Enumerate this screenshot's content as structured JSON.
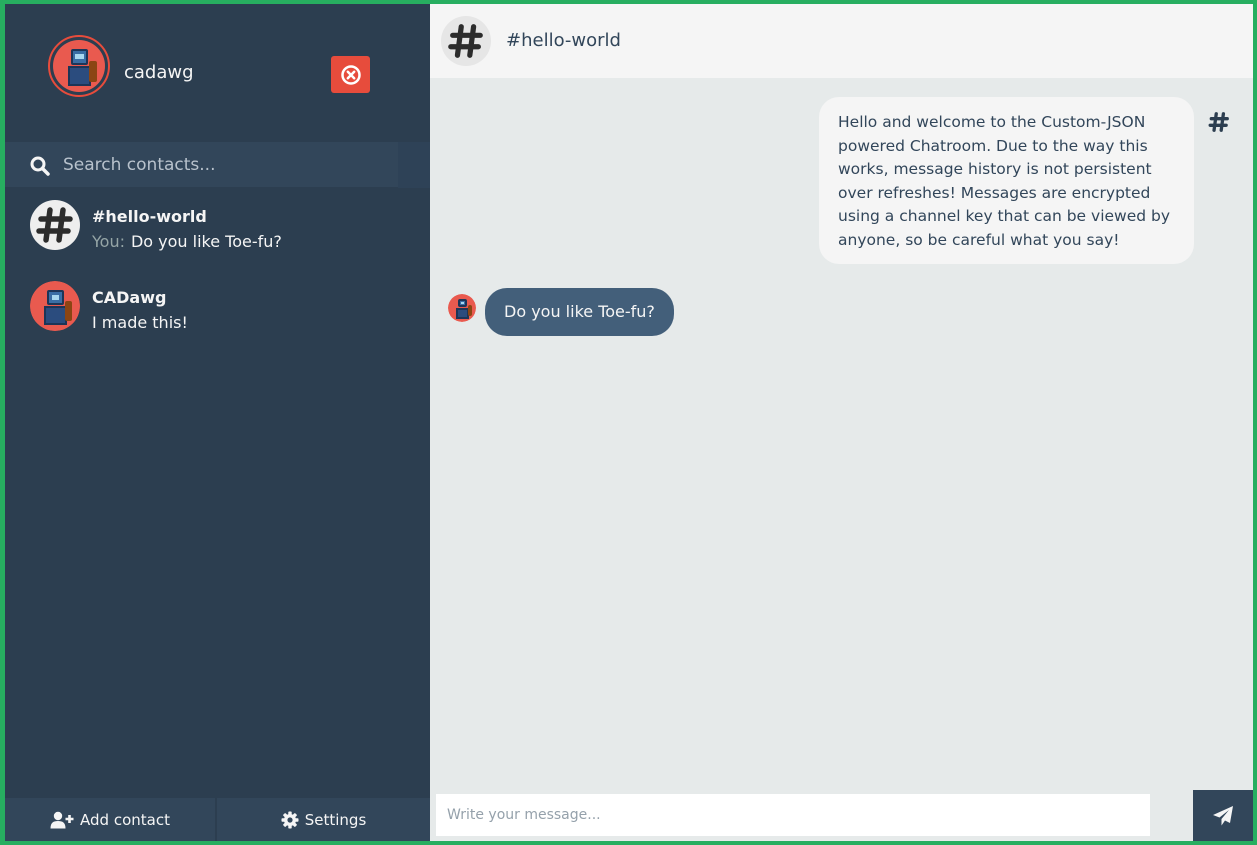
{
  "profile": {
    "username": "cadawg"
  },
  "search": {
    "placeholder": "Search contacts..."
  },
  "contacts": [
    {
      "name": "#hello-world",
      "sender_label": "You:",
      "preview": "Do you like Toe-fu?"
    },
    {
      "name": "CADawg",
      "preview": "I made this!"
    }
  ],
  "bottom_bar": {
    "add_contact_label": "Add contact",
    "settings_label": "Settings"
  },
  "chat": {
    "title": "#hello-world",
    "messages": [
      {
        "text": "Hello and welcome to the Custom-JSON powered Chatroom. Due to the way this works, message history is not persistent over refreshes! Messages are encrypted using a channel key that can be viewed by anyone, so be careful what you say!"
      },
      {
        "text": "Do you like Toe-fu?"
      }
    ]
  },
  "composer": {
    "placeholder": "Write your message..."
  },
  "colors": {
    "sidebar_bg": "#2c3e50",
    "panel_bg": "#32465a",
    "accent_red": "#e74c3c",
    "bubble_dark": "#435f7a",
    "frame_green": "#27ae60"
  },
  "icons": {
    "close": "close-circle-icon",
    "search": "search-icon",
    "hash": "hash-icon",
    "add_user": "user-plus-icon",
    "settings": "gear-icon",
    "send": "paper-plane-icon"
  }
}
